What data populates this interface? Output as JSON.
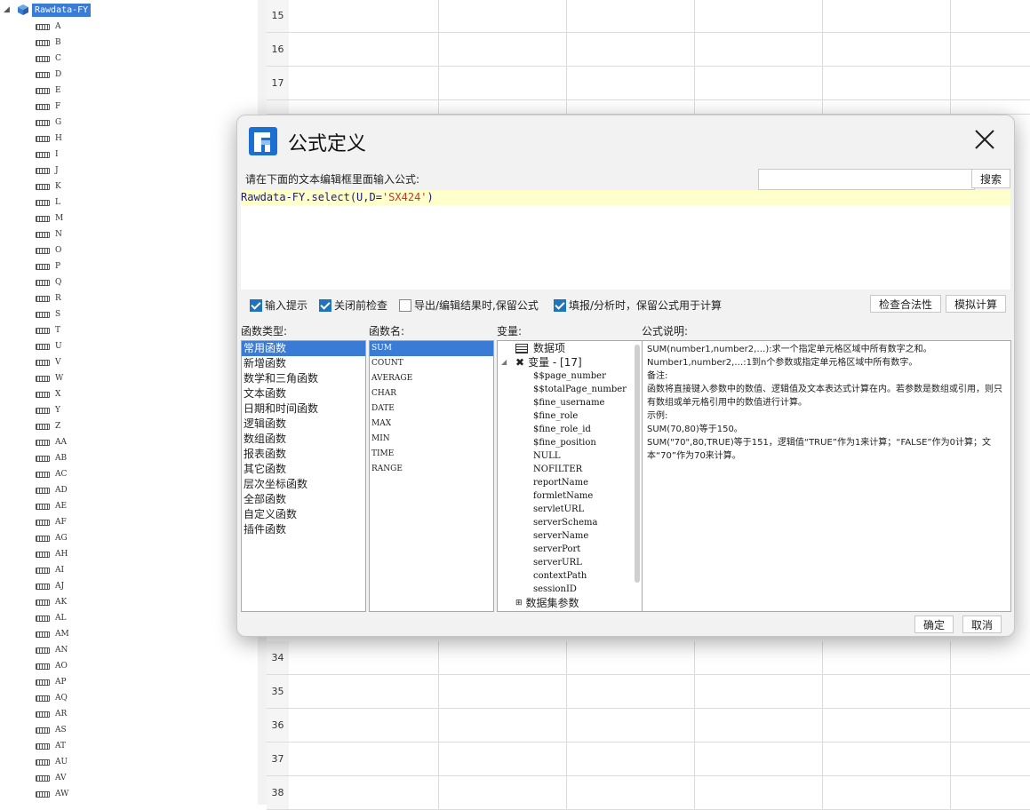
{
  "tree": {
    "root_label": "Rawdata-FY",
    "columns": [
      "A",
      "B",
      "C",
      "D",
      "E",
      "F",
      "G",
      "H",
      "I",
      "J",
      "K",
      "L",
      "M",
      "N",
      "O",
      "P",
      "Q",
      "R",
      "S",
      "T",
      "U",
      "V",
      "W",
      "X",
      "Y",
      "Z",
      "AA",
      "AB",
      "AC",
      "AD",
      "AE",
      "AF",
      "AG",
      "AH",
      "AI",
      "AJ",
      "AK",
      "AL",
      "AM",
      "AN",
      "AO",
      "AP",
      "AQ",
      "AR",
      "AS",
      "AT",
      "AU",
      "AV",
      "AW"
    ]
  },
  "sheet": {
    "top_rows": [
      "15",
      "16",
      "17"
    ],
    "bottom_rows": [
      "34",
      "35",
      "36",
      "37",
      "38"
    ]
  },
  "dialog": {
    "title": "公式定义",
    "prompt": "请在下面的文本编辑框里面输入公式:",
    "search_placeholder": "",
    "search_button": "搜索",
    "formula_prefix": "Rawdata-FY.select(U,D=",
    "formula_string": "'SX424'",
    "formula_suffix": ")",
    "options": [
      {
        "label": "输入提示",
        "checked": true
      },
      {
        "label": "关闭前检查",
        "checked": true
      },
      {
        "label": "导出/编辑结果时,保留公式",
        "checked": false
      },
      {
        "label": "填报/分析时，保留公式用于计算",
        "checked": true
      }
    ],
    "check_button": "检查合法性",
    "simulate_button": "模拟计算",
    "categories_label": "函数类型:",
    "functions_label": "函数名:",
    "variables_label": "变量:",
    "description_label": "公式说明:",
    "categories": [
      "常用函数",
      "新增函数",
      "数学和三角函数",
      "文本函数",
      "日期和时间函数",
      "逻辑函数",
      "数组函数",
      "报表函数",
      "其它函数",
      "层次坐标函数",
      "全部函数",
      "自定义函数",
      "插件函数"
    ],
    "selected_category": 0,
    "functions": [
      "SUM",
      "COUNT",
      "AVERAGE",
      "CHAR",
      "DATE",
      "MAX",
      "MIN",
      "TIME",
      "RANGE"
    ],
    "selected_function": 0,
    "variables": {
      "data_item": "数据项",
      "variable_group": "变量 - [17]",
      "items": [
        "$$page_number",
        "$$totalPage_number",
        "$fine_username",
        "$fine_role",
        "$fine_role_id",
        "$fine_position",
        "NULL",
        "NOFILTER",
        "reportName",
        "formletName",
        "servletURL",
        "serverSchema",
        "serverName",
        "serverPort",
        "serverURL",
        "contextPath",
        "sessionID"
      ],
      "dataset_params": "数据集参数"
    },
    "description": [
      "SUM(number1,number2,…):求一个指定单元格区域中所有数字之和。",
      "Number1,number2,…:1到n个参数或指定单元格区域中所有数字。",
      "备注:",
      "函数将直接键入参数中的数值、逻辑值及文本表达式计算在内。若参数是数组或引用，则只有数组或单元格引用中的数值进行计算。",
      "示例:",
      "SUM(70,80)等于150。",
      "SUM(\"70\",80,TRUE)等于151，逻辑值“TRUE”作为1来计算；“FALSE”作为0计算；文本“70”作为70来计算。"
    ],
    "ok_button": "确定",
    "cancel_button": "取消"
  }
}
